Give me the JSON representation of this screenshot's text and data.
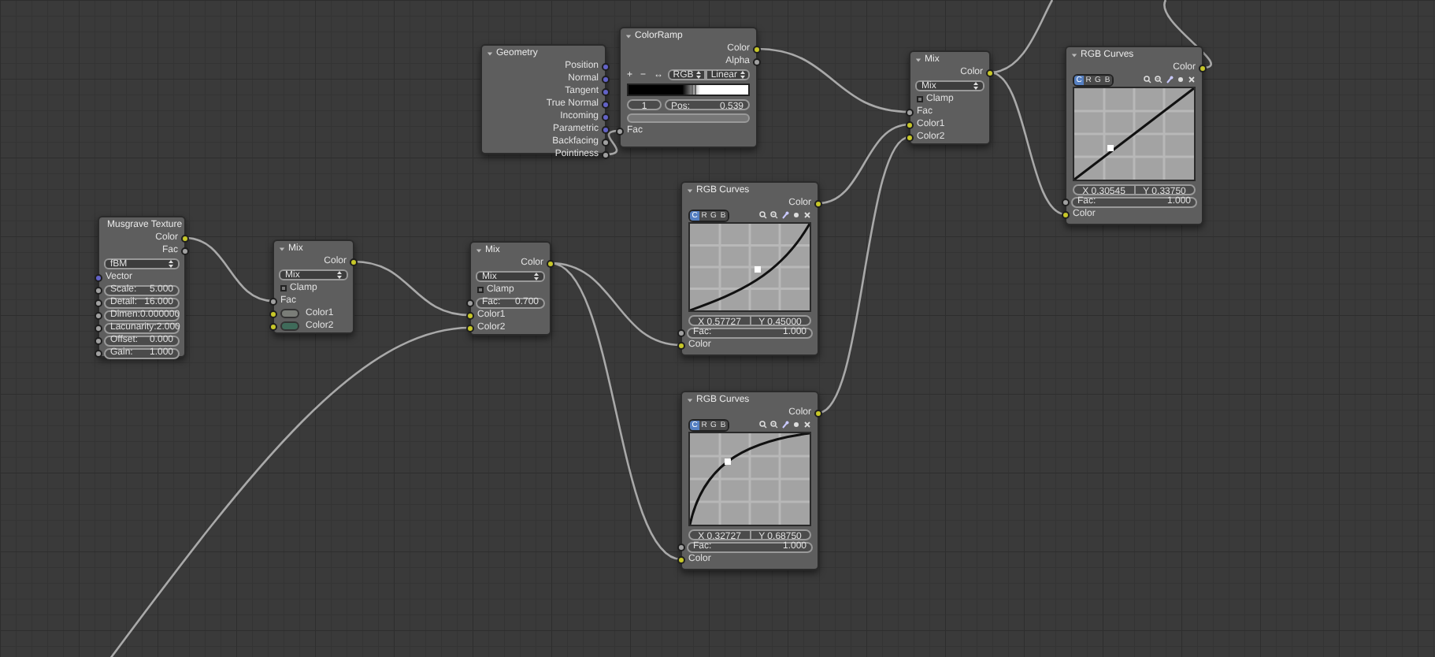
{
  "nodes": [
    {
      "title": "Geometry",
      "rows": [
        {
          "kind": "output",
          "label": "Position",
          "socket": {
            "color": "#6363c7"
          }
        },
        {
          "kind": "output",
          "label": "Normal",
          "socket": {
            "color": "#6363c7"
          }
        },
        {
          "kind": "output",
          "label": "Tangent",
          "socket": {
            "color": "#6363c7"
          }
        },
        {
          "kind": "output",
          "label": "True Normal",
          "socket": {
            "color": "#6363c7"
          }
        },
        {
          "kind": "output",
          "label": "Incoming",
          "socket": {
            "color": "#6363c7"
          }
        },
        {
          "kind": "output",
          "label": "Parametric",
          "socket": {
            "color": "#6363c7"
          }
        },
        {
          "kind": "output",
          "label": "Backfacing",
          "socket": {
            "color": "#a1a1a1"
          }
        },
        {
          "kind": "output",
          "label": "Pointiness",
          "socket": {
            "color": "#a1a1a1"
          }
        }
      ]
    },
    {
      "title": "ColorRamp",
      "rows": [
        {
          "kind": "output",
          "label": "Color",
          "socket": {
            "color": "#c7c729"
          }
        },
        {
          "kind": "output",
          "label": "Alpha",
          "socket": {
            "color": "#a1a1a1"
          }
        },
        {
          "kind": "ramp",
          "tools": [
            "+",
            "−",
            "↔"
          ],
          "color_mode": "RGB",
          "interpolation": "Linear",
          "index": "1",
          "pos_label": "Pos:",
          "pos_value": "0.539"
        },
        {
          "kind": "input",
          "label": "Fac",
          "socket": {
            "color": "#a1a1a1"
          }
        }
      ]
    },
    {
      "title": "Mix",
      "rows": [
        {
          "kind": "output",
          "label": "Color",
          "socket": {
            "color": "#c7c729"
          }
        },
        {
          "kind": "dropdown",
          "value": "Mix"
        },
        {
          "kind": "checkbox",
          "label": "Clamp",
          "checked": false
        },
        {
          "kind": "input",
          "label": "Fac",
          "socket": {
            "color": "#a1a1a1"
          }
        },
        {
          "kind": "input",
          "label": "Color1",
          "socket": {
            "color": "#c7c729"
          }
        },
        {
          "kind": "input",
          "label": "Color2",
          "socket": {
            "color": "#c7c729"
          }
        }
      ]
    },
    {
      "title": "RGB Curves",
      "rows": [
        {
          "kind": "output",
          "label": "Color",
          "socket": {
            "color": "#c7c729"
          }
        },
        {
          "kind": "curve",
          "channels": [
            {
              "label": "C",
              "selected": true
            },
            {
              "label": "R",
              "selected": false
            },
            {
              "label": "G",
              "selected": false
            },
            {
              "label": "B",
              "selected": false
            }
          ],
          "curve": {
            "kind": "linear"
          },
          "x": "X 0.30545",
          "y": "Y 0.33750"
        },
        {
          "kind": "field",
          "label": "Fac:",
          "value": "1.000",
          "socket": {
            "color": "#a1a1a1"
          }
        },
        {
          "kind": "input",
          "label": "Color",
          "socket": {
            "color": "#c7c729"
          }
        }
      ]
    },
    {
      "title": "Musgrave Texture",
      "rows": [
        {
          "kind": "output",
          "label": "Color",
          "socket": {
            "color": "#c7c729"
          }
        },
        {
          "kind": "output",
          "label": "Fac",
          "socket": {
            "color": "#a1a1a1"
          }
        },
        {
          "kind": "dropdown",
          "value": "fBM"
        },
        {
          "kind": "input",
          "label": "Vector",
          "socket": {
            "color": "#6363c7"
          }
        },
        {
          "kind": "field",
          "label": "Scale:",
          "value": "5.000",
          "socket": {
            "color": "#a1a1a1"
          }
        },
        {
          "kind": "field",
          "label": "Detail:",
          "value": "16.000",
          "socket": {
            "color": "#a1a1a1"
          }
        },
        {
          "kind": "field",
          "label": "Dimen:",
          "value": "0.000000",
          "socket": {
            "color": "#a1a1a1"
          }
        },
        {
          "kind": "field",
          "label": "Lacunarity:",
          "value": "2.000",
          "socket": {
            "color": "#a1a1a1"
          }
        },
        {
          "kind": "field",
          "label": "Offset:",
          "value": "0.000",
          "socket": {
            "color": "#a1a1a1"
          }
        },
        {
          "kind": "field",
          "label": "Gain:",
          "value": "1.000",
          "socket": {
            "color": "#a1a1a1"
          }
        }
      ]
    },
    {
      "title": "Mix",
      "rows": [
        {
          "kind": "output",
          "label": "Color",
          "socket": {
            "color": "#c7c729"
          }
        },
        {
          "kind": "dropdown",
          "value": "Mix"
        },
        {
          "kind": "checkbox",
          "label": "Clamp",
          "checked": false
        },
        {
          "kind": "input",
          "label": "Fac",
          "socket": {
            "color": "#a1a1a1"
          }
        },
        {
          "kind": "swatch",
          "label": "Color1",
          "socket": {
            "color": "#c7c729"
          },
          "color": "#7a7d78"
        },
        {
          "kind": "swatch",
          "label": "Color2",
          "socket": {
            "color": "#c7c729"
          },
          "color": "#3f6b5a"
        }
      ]
    },
    {
      "title": "Mix",
      "rows": [
        {
          "kind": "output",
          "label": "Color",
          "socket": {
            "color": "#c7c729"
          }
        },
        {
          "kind": "dropdown",
          "value": "Mix"
        },
        {
          "kind": "checkbox",
          "label": "Clamp",
          "checked": false
        },
        {
          "kind": "field",
          "label": "Fac:",
          "value": "0.700",
          "socket": {
            "color": "#a1a1a1"
          }
        },
        {
          "kind": "input",
          "label": "Color1",
          "socket": {
            "color": "#c7c729"
          }
        },
        {
          "kind": "input",
          "label": "Color2",
          "socket": {
            "color": "#c7c729"
          }
        }
      ]
    },
    {
      "title": "RGB Curves",
      "rows": [
        {
          "kind": "output",
          "label": "Color",
          "socket": {
            "color": "#c7c729"
          }
        },
        {
          "kind": "curve",
          "channels": [
            {
              "label": "C",
              "selected": true
            },
            {
              "label": "R",
              "selected": false
            },
            {
              "label": "G",
              "selected": false
            },
            {
              "label": "B",
              "selected": false
            }
          ],
          "curve": {
            "kind": "ease-in"
          },
          "x": "X 0.57727",
          "y": "Y 0.45000"
        },
        {
          "kind": "field",
          "label": "Fac:",
          "value": "1.000",
          "socket": {
            "color": "#a1a1a1"
          }
        },
        {
          "kind": "input",
          "label": "Color",
          "socket": {
            "color": "#c7c729"
          }
        }
      ]
    },
    {
      "title": "RGB Curves",
      "rows": [
        {
          "kind": "output",
          "label": "Color",
          "socket": {
            "color": "#c7c729"
          }
        },
        {
          "kind": "curve",
          "channels": [
            {
              "label": "C",
              "selected": true
            },
            {
              "label": "R",
              "selected": false
            },
            {
              "label": "G",
              "selected": false
            },
            {
              "label": "B",
              "selected": false
            }
          ],
          "curve": {
            "kind": "ease-out"
          },
          "x": "X 0.32727",
          "y": "Y 0.68750"
        },
        {
          "kind": "field",
          "label": "Fac:",
          "value": "1.000",
          "socket": {
            "color": "#a1a1a1"
          }
        },
        {
          "kind": "input",
          "label": "Color",
          "socket": {
            "color": "#c7c729"
          }
        }
      ]
    }
  ]
}
